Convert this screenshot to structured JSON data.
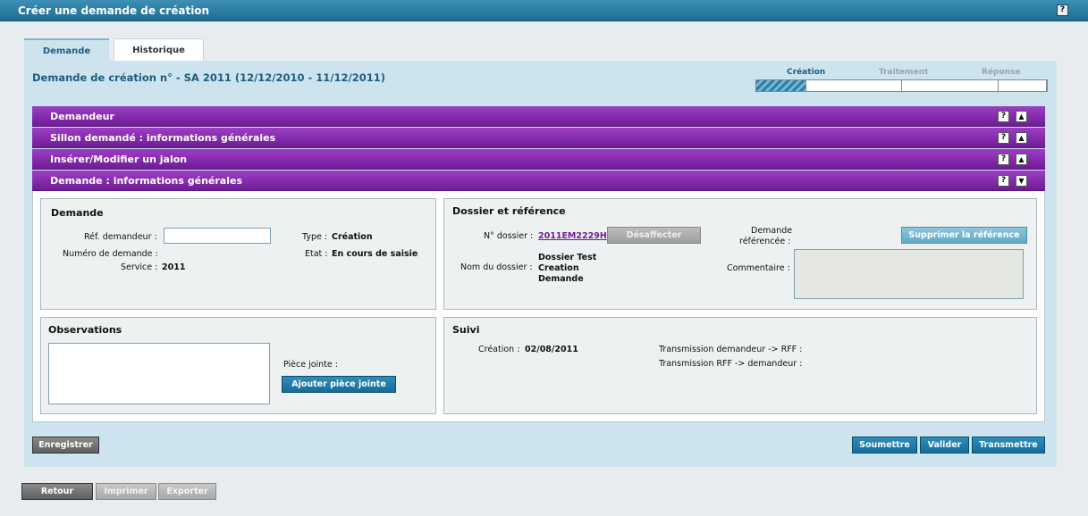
{
  "window": {
    "title": "Créer une demande de création",
    "help_label": "?"
  },
  "tabs": [
    {
      "label": "Demande"
    },
    {
      "label": "Historique"
    }
  ],
  "page_title": "Demande de création n° - SA 2011 (12/12/2010 - 11/12/2011)",
  "progress": {
    "steps": [
      "Création",
      "Traitement",
      "Réponse"
    ],
    "current_step": "Création"
  },
  "sections": [
    {
      "label": "Demandeur",
      "help": "?",
      "arrow": "▲"
    },
    {
      "label": "Sillon demandé : informations générales",
      "help": "?",
      "arrow": "▲"
    },
    {
      "label": "Insérer/Modifier un jalon",
      "help": "?",
      "arrow": "▲"
    },
    {
      "label": "Demande : informations générales",
      "help": "?",
      "arrow": "▼"
    }
  ],
  "demande": {
    "title": "Demande",
    "ref_label": "Réf. demandeur :",
    "ref_value": "",
    "numero_label": "Numéro de demande :",
    "service_label": "Service :",
    "service_value": "2011",
    "type_label": "Type :",
    "type_value": "Création",
    "etat_label": "Etat :",
    "etat_value": "En cours de saisie"
  },
  "dossier": {
    "title": "Dossier et référence",
    "num_label": "N° dossier :",
    "num_value": "2011EM2229H",
    "desaffecter_label": "Désaffecter",
    "nom_label": "Nom du dossier :",
    "nom_value_1": "Dossier Test",
    "nom_value_2": "Creation",
    "nom_value_3": "Demande",
    "demande_ref_label_1": "Demande",
    "demande_ref_label_2": "référencée :",
    "supprimer_label": "Supprimer la référence",
    "commentaire_label": "Commentaire :",
    "commentaire_value": ""
  },
  "observations": {
    "title": "Observations",
    "text_value": "",
    "piece_label": "Pièce jointe :",
    "ajouter_label": "Ajouter pièce jointe"
  },
  "suivi": {
    "title": "Suivi",
    "creation_label": "Création :",
    "creation_value": "02/08/2011",
    "trans1_label": "Transmission demandeur -> RFF :",
    "trans2_label": "Transmission RFF -> demandeur :"
  },
  "actions": {
    "enregistrer": "Enregistrer",
    "soumettre": "Soumettre",
    "valider": "Valider",
    "transmettre": "Transmettre"
  },
  "footer": {
    "retour": "Retour",
    "imprimer": "Imprimer",
    "exporter": "Exporter"
  },
  "colors": {
    "accent": "#1d5d82",
    "section_bar": "#8a2eb3",
    "panel_bg": "#cde4ee"
  }
}
